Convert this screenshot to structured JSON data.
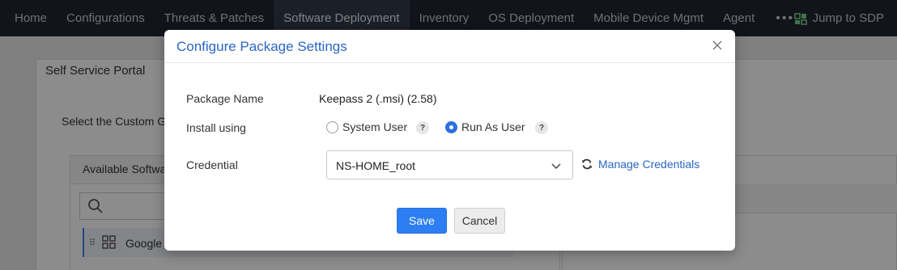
{
  "nav": {
    "items": [
      {
        "label": "Home"
      },
      {
        "label": "Configurations"
      },
      {
        "label": "Threats & Patches"
      },
      {
        "label": "Software Deployment"
      },
      {
        "label": "Inventory"
      },
      {
        "label": "OS Deployment"
      },
      {
        "label": "Mobile Device Mgmt"
      },
      {
        "label": "Agent"
      }
    ],
    "more_label": "•••",
    "jump_label": "Jump to SDP"
  },
  "background": {
    "card_title": "Self Service Portal",
    "select_text": "Select the Custom Gro",
    "panel_title": "Available Softwar",
    "row_label": "Google C",
    "row_drag": "⠿"
  },
  "modal": {
    "title": "Configure Package Settings",
    "package_name_label": "Package Name",
    "package_name_value": "Keepass 2 (.msi) (2.58)",
    "install_using_label": "Install using",
    "system_user_label": "System User",
    "run_as_user_label": "Run As User",
    "selected_install": "Run As User",
    "help_glyph": "?",
    "credential_label": "Credential",
    "credential_value": "NS-HOME_root",
    "manage_credentials_label": "Manage Credentials",
    "save_label": "Save",
    "cancel_label": "Cancel"
  },
  "colors": {
    "accent": "#2d7ef2",
    "title_blue": "#2a66c4",
    "nav_bg": "#1f2532"
  }
}
